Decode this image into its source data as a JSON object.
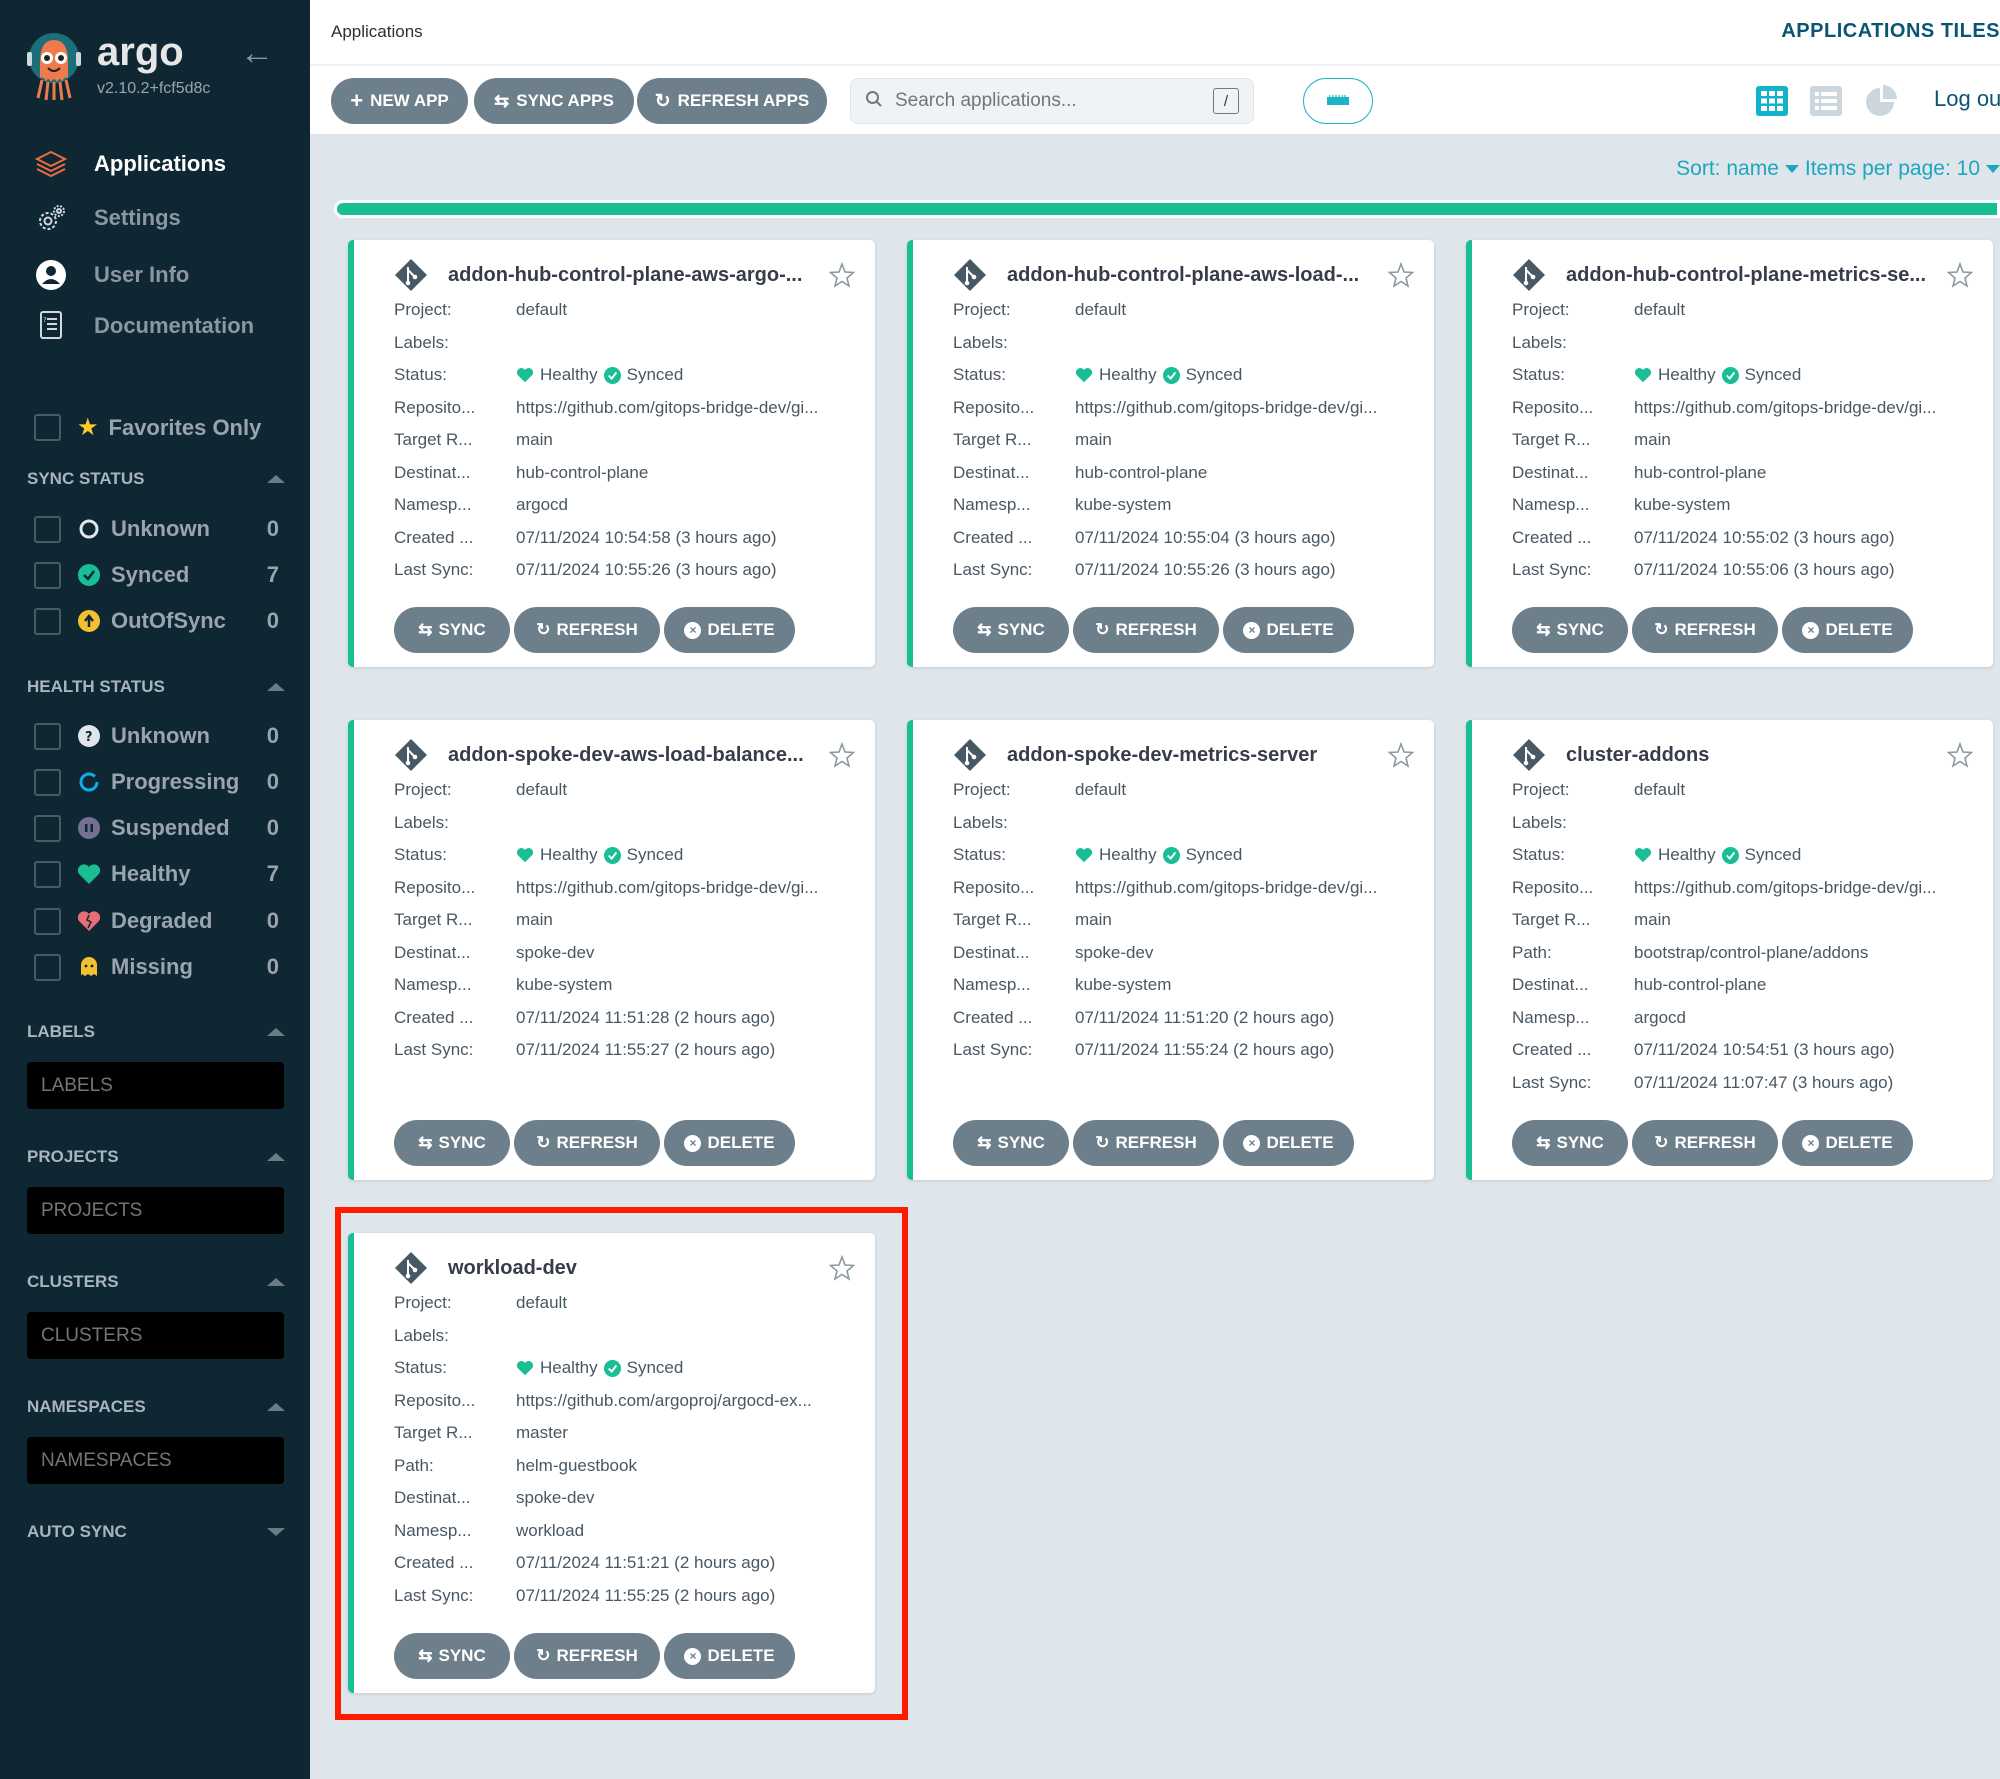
{
  "sidebar": {
    "brand": "argo",
    "version": "v2.10.2+fcf5d8c",
    "nav": [
      {
        "label": "Applications",
        "icon": "layers-icon",
        "active": true
      },
      {
        "label": "Settings",
        "icon": "gears-icon"
      },
      {
        "label": "User Info",
        "icon": "user-icon"
      },
      {
        "label": "Documentation",
        "icon": "book-icon"
      }
    ],
    "favorites_label": "Favorites Only",
    "sync_status": {
      "title": "SYNC STATUS",
      "items": [
        {
          "label": "Unknown",
          "count": "0",
          "icon": "circle-outline-icon"
        },
        {
          "label": "Synced",
          "count": "7",
          "icon": "check-circle-icon"
        },
        {
          "label": "OutOfSync",
          "count": "0",
          "icon": "arrow-up-circle-icon"
        }
      ]
    },
    "health_status": {
      "title": "HEALTH STATUS",
      "items": [
        {
          "label": "Unknown",
          "count": "0",
          "icon": "question-circle-icon"
        },
        {
          "label": "Progressing",
          "count": "0",
          "icon": "spinner-icon"
        },
        {
          "label": "Suspended",
          "count": "0",
          "icon": "pause-circle-icon"
        },
        {
          "label": "Healthy",
          "count": "7",
          "icon": "heart-icon"
        },
        {
          "label": "Degraded",
          "count": "0",
          "icon": "broken-heart-icon"
        },
        {
          "label": "Missing",
          "count": "0",
          "icon": "ghost-icon"
        }
      ]
    },
    "labels": {
      "title": "LABELS",
      "placeholder": "LABELS"
    },
    "projects": {
      "title": "PROJECTS",
      "placeholder": "PROJECTS"
    },
    "clusters": {
      "title": "CLUSTERS",
      "placeholder": "CLUSTERS"
    },
    "namespaces": {
      "title": "NAMESPACES",
      "placeholder": "NAMESPACES"
    },
    "auto_sync": {
      "title": "AUTO SYNC"
    }
  },
  "header": {
    "breadcrumb": "Applications",
    "title": "APPLICATIONS TILES"
  },
  "toolbar": {
    "new_app": "NEW APP",
    "sync_apps": "SYNC APPS",
    "refresh_apps": "REFRESH APPS",
    "search_placeholder": "Search applications...",
    "search_shortcut": "/",
    "logout": "Log out"
  },
  "sort": {
    "sort_label": "Sort: name",
    "items_per_page": "Items per page: 10"
  },
  "sync_progress": {
    "synced_fraction": 1.0,
    "color": "#18be94"
  },
  "card_actions": {
    "sync": "SYNC",
    "refresh": "REFRESH",
    "delete": "DELETE"
  },
  "status_labels": {
    "health": "Healthy",
    "sync": "Synced"
  },
  "apps": [
    {
      "name": "addon-hub-control-plane-aws-argo-...",
      "fields": [
        {
          "k": "Project:",
          "v": "default"
        },
        {
          "k": "Labels:",
          "v": ""
        },
        {
          "k": "Status:",
          "v": "__status__"
        },
        {
          "k": "Reposito...",
          "v": "https://github.com/gitops-bridge-dev/gi..."
        },
        {
          "k": "Target R...",
          "v": "main"
        },
        {
          "k": "Destinat...",
          "v": "hub-control-plane"
        },
        {
          "k": "Namesp...",
          "v": "argocd"
        },
        {
          "k": "Created ...",
          "v": "07/11/2024 10:54:58  (3 hours ago)"
        },
        {
          "k": "Last Sync:",
          "v": "07/11/2024 10:55:26  (3 hours ago)"
        }
      ]
    },
    {
      "name": "addon-hub-control-plane-aws-load-...",
      "fields": [
        {
          "k": "Project:",
          "v": "default"
        },
        {
          "k": "Labels:",
          "v": ""
        },
        {
          "k": "Status:",
          "v": "__status__"
        },
        {
          "k": "Reposito...",
          "v": "https://github.com/gitops-bridge-dev/gi..."
        },
        {
          "k": "Target R...",
          "v": "main"
        },
        {
          "k": "Destinat...",
          "v": "hub-control-plane"
        },
        {
          "k": "Namesp...",
          "v": "kube-system"
        },
        {
          "k": "Created ...",
          "v": "07/11/2024 10:55:04  (3 hours ago)"
        },
        {
          "k": "Last Sync:",
          "v": "07/11/2024 10:55:26  (3 hours ago)"
        }
      ]
    },
    {
      "name": "addon-hub-control-plane-metrics-se...",
      "fields": [
        {
          "k": "Project:",
          "v": "default"
        },
        {
          "k": "Labels:",
          "v": ""
        },
        {
          "k": "Status:",
          "v": "__status__"
        },
        {
          "k": "Reposito...",
          "v": "https://github.com/gitops-bridge-dev/gi..."
        },
        {
          "k": "Target R...",
          "v": "main"
        },
        {
          "k": "Destinat...",
          "v": "hub-control-plane"
        },
        {
          "k": "Namesp...",
          "v": "kube-system"
        },
        {
          "k": "Created ...",
          "v": "07/11/2024 10:55:02  (3 hours ago)"
        },
        {
          "k": "Last Sync:",
          "v": "07/11/2024 10:55:06  (3 hours ago)"
        }
      ]
    },
    {
      "name": "addon-spoke-dev-aws-load-balance...",
      "fields": [
        {
          "k": "Project:",
          "v": "default"
        },
        {
          "k": "Labels:",
          "v": ""
        },
        {
          "k": "Status:",
          "v": "__status__"
        },
        {
          "k": "Reposito...",
          "v": "https://github.com/gitops-bridge-dev/gi..."
        },
        {
          "k": "Target R...",
          "v": "main"
        },
        {
          "k": "Destinat...",
          "v": "spoke-dev"
        },
        {
          "k": "Namesp...",
          "v": "kube-system"
        },
        {
          "k": "Created ...",
          "v": "07/11/2024 11:51:28  (2 hours ago)"
        },
        {
          "k": "Last Sync:",
          "v": "07/11/2024 11:55:27  (2 hours ago)"
        }
      ]
    },
    {
      "name": "addon-spoke-dev-metrics-server",
      "fields": [
        {
          "k": "Project:",
          "v": "default"
        },
        {
          "k": "Labels:",
          "v": ""
        },
        {
          "k": "Status:",
          "v": "__status__"
        },
        {
          "k": "Reposito...",
          "v": "https://github.com/gitops-bridge-dev/gi..."
        },
        {
          "k": "Target R...",
          "v": "main"
        },
        {
          "k": "Destinat...",
          "v": "spoke-dev"
        },
        {
          "k": "Namesp...",
          "v": "kube-system"
        },
        {
          "k": "Created ...",
          "v": "07/11/2024 11:51:20  (2 hours ago)"
        },
        {
          "k": "Last Sync:",
          "v": "07/11/2024 11:55:24  (2 hours ago)"
        }
      ]
    },
    {
      "name": "cluster-addons",
      "fields": [
        {
          "k": "Project:",
          "v": "default"
        },
        {
          "k": "Labels:",
          "v": ""
        },
        {
          "k": "Status:",
          "v": "__status__"
        },
        {
          "k": "Reposito...",
          "v": "https://github.com/gitops-bridge-dev/gi..."
        },
        {
          "k": "Target R...",
          "v": "main"
        },
        {
          "k": "Path:",
          "v": "bootstrap/control-plane/addons"
        },
        {
          "k": "Destinat...",
          "v": "hub-control-plane"
        },
        {
          "k": "Namesp...",
          "v": "argocd"
        },
        {
          "k": "Created ...",
          "v": "07/11/2024 10:54:51  (3 hours ago)"
        },
        {
          "k": "Last Sync:",
          "v": "07/11/2024 11:07:47  (3 hours ago)"
        }
      ]
    },
    {
      "name": "workload-dev",
      "highlighted": true,
      "fields": [
        {
          "k": "Project:",
          "v": "default"
        },
        {
          "k": "Labels:",
          "v": ""
        },
        {
          "k": "Status:",
          "v": "__status__"
        },
        {
          "k": "Reposito...",
          "v": "https://github.com/argoproj/argocd-ex..."
        },
        {
          "k": "Target R...",
          "v": "master"
        },
        {
          "k": "Path:",
          "v": "helm-guestbook"
        },
        {
          "k": "Destinat...",
          "v": "spoke-dev"
        },
        {
          "k": "Namesp...",
          "v": "workload"
        },
        {
          "k": "Created ...",
          "v": "07/11/2024 11:51:21  (2 hours ago)"
        },
        {
          "k": "Last Sync:",
          "v": "07/11/2024 11:55:25  (2 hours ago)"
        }
      ]
    }
  ]
}
